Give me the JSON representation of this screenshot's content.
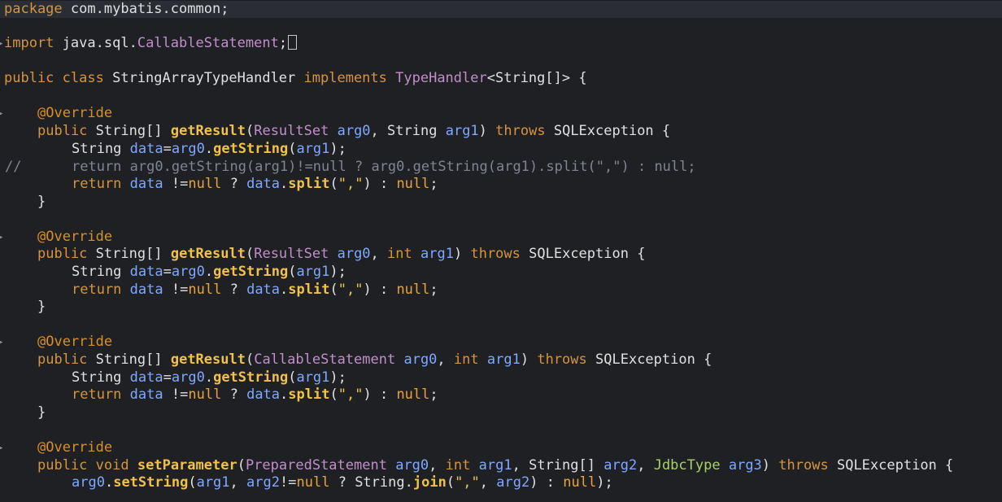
{
  "editor": {
    "lines": [
      {
        "id": "package",
        "text": "package com.mybatis.common;"
      },
      {
        "id": "import",
        "text": "import java.sql.CallableStatement;"
      },
      {
        "id": "class-decl",
        "text": "public class StringArrayTypeHandler implements TypeHandler<String[]> {"
      },
      {
        "id": "override1",
        "text": "@Override"
      },
      {
        "id": "method1",
        "text": "public String[] getResult(ResultSet arg0, String arg1) throws SQLException {"
      },
      {
        "id": "m1-body1",
        "text": "String data=arg0.getString(arg1);"
      },
      {
        "id": "m1-comment",
        "text": "return arg0.getString(arg1)!=null ? arg0.getString(arg1).split(\",\") : null;"
      },
      {
        "id": "m1-return",
        "text": "return data !=null ? data.split(\",\") : null;"
      },
      {
        "id": "m1-close",
        "text": "}"
      },
      {
        "id": "override2",
        "text": "@Override"
      },
      {
        "id": "method2",
        "text": "public String[] getResult(ResultSet arg0, int arg1) throws SQLException {"
      },
      {
        "id": "m2-body1",
        "text": "String data=arg0.getString(arg1);"
      },
      {
        "id": "m2-return",
        "text": "return data !=null ? data.split(\",\") : null;"
      },
      {
        "id": "m2-close",
        "text": "}"
      },
      {
        "id": "override3",
        "text": "@Override"
      },
      {
        "id": "method3",
        "text": "public String[] getResult(CallableStatement arg0, int arg1) throws SQLException {"
      },
      {
        "id": "m3-body1",
        "text": "String data=arg0.getString(arg1);"
      },
      {
        "id": "m3-return",
        "text": "return data !=null ? data.split(\",\") : null;"
      },
      {
        "id": "m3-close",
        "text": "}"
      },
      {
        "id": "override4",
        "text": "@Override"
      },
      {
        "id": "method4",
        "text": "public void setParameter(PreparedStatement arg0, int arg1, String[] arg2, JdbcType arg3) throws SQLException {"
      },
      {
        "id": "m4-body1",
        "text": "arg0.setString(arg1, arg2!=null ? String.join(\",\", arg2) : null);"
      }
    ],
    "comment_prefix": "//"
  }
}
